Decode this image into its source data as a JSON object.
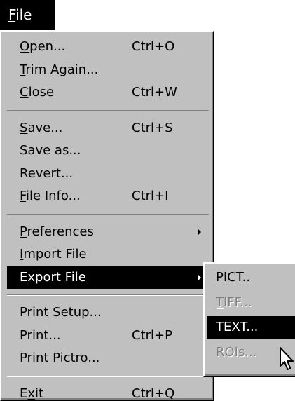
{
  "menu_title": {
    "label": "File",
    "mnemonic_index": 0
  },
  "menu": {
    "groups": [
      [
        {
          "label": "Open...",
          "mnemonic": "O",
          "shortcut": "Ctrl+O"
        },
        {
          "label": "Trim Again...",
          "mnemonic": "T",
          "shortcut": ""
        },
        {
          "label": "Close",
          "mnemonic": "C",
          "shortcut": "Ctrl+W"
        }
      ],
      [
        {
          "label": "Save...",
          "mnemonic": "S",
          "shortcut": "Ctrl+S"
        },
        {
          "label": "Save as...",
          "mnemonic": "a",
          "shortcut": ""
        },
        {
          "label": "Revert...",
          "mnemonic": "",
          "shortcut": ""
        },
        {
          "label": "File Info...",
          "mnemonic": "F",
          "shortcut": "Ctrl+I"
        }
      ],
      [
        {
          "label": "Preferences",
          "mnemonic": "P",
          "shortcut": "",
          "has_submenu": true
        },
        {
          "label": "Import File",
          "mnemonic": "I",
          "shortcut": ""
        },
        {
          "label": "Export File",
          "mnemonic": "E",
          "shortcut": "",
          "has_submenu": true,
          "state": "selected"
        }
      ],
      [
        {
          "label": "Print Setup...",
          "mnemonic": "r",
          "shortcut": ""
        },
        {
          "label": "Print...",
          "mnemonic": "n",
          "shortcut": "Ctrl+P"
        },
        {
          "label": "Print Pictro...",
          "mnemonic": "",
          "shortcut": ""
        }
      ],
      [
        {
          "label": "Exit",
          "mnemonic": "x",
          "shortcut": "Ctrl+Q"
        }
      ]
    ]
  },
  "export_submenu": {
    "items": [
      {
        "label": "PICT..",
        "mnemonic": "P",
        "state": "enabled"
      },
      {
        "label": "TIFF...",
        "mnemonic": "T",
        "state": "disabled"
      },
      {
        "label": "TEXT...",
        "mnemonic": "",
        "state": "selected"
      },
      {
        "label": "ROIs...",
        "mnemonic": "",
        "state": "disabled"
      }
    ]
  },
  "icons": {
    "cursor": "arrow-pointer-icon",
    "submenu_arrow": "triangle-right-icon"
  },
  "colors": {
    "menu_bg": "#c0c0c0",
    "highlight": "#000000",
    "highlight_text": "#ffffff",
    "disabled_text": "#808080"
  }
}
